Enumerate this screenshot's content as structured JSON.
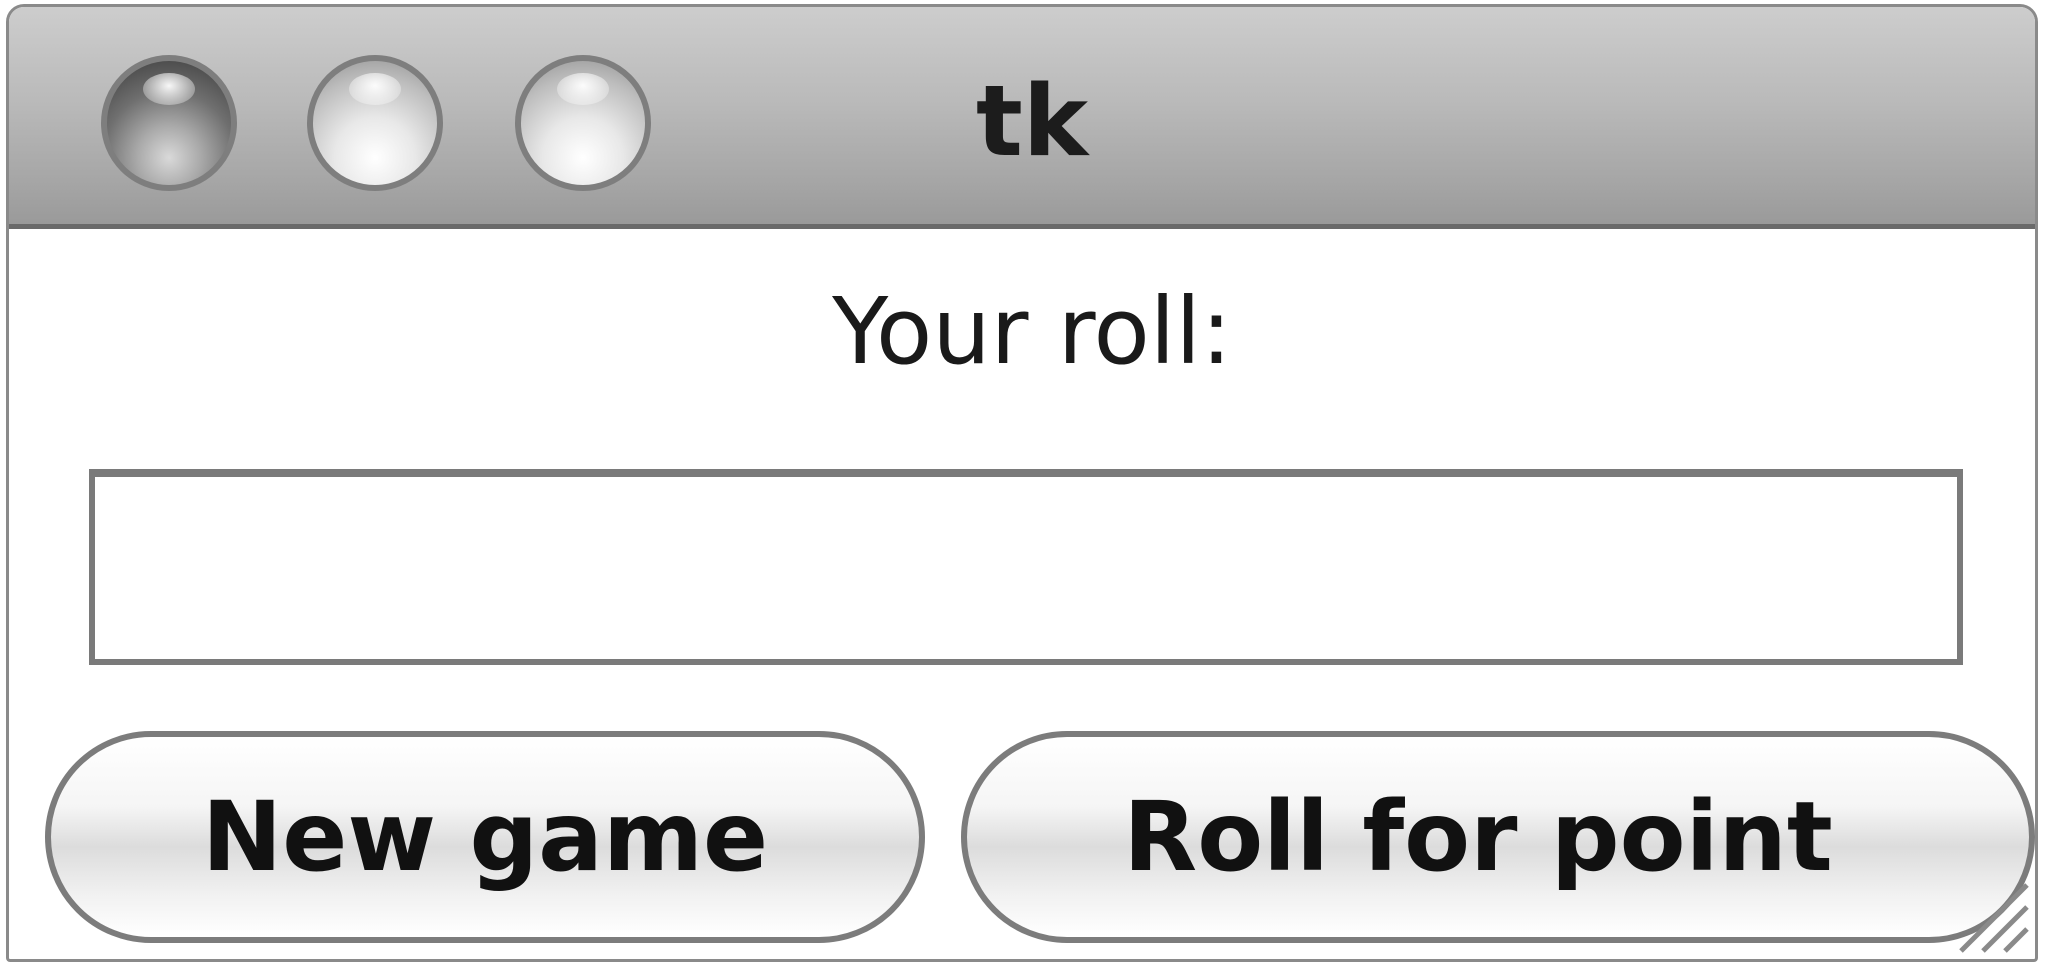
{
  "window": {
    "title": "tk"
  },
  "main": {
    "roll_label": "Your roll:",
    "roll_value": "",
    "buttons": {
      "new_game": "New game",
      "roll_for_point": "Roll for point"
    }
  },
  "icons": {
    "close": "close-icon",
    "minimize": "minimize-icon",
    "zoom": "zoom-icon",
    "resize": "resize-grip-icon"
  }
}
